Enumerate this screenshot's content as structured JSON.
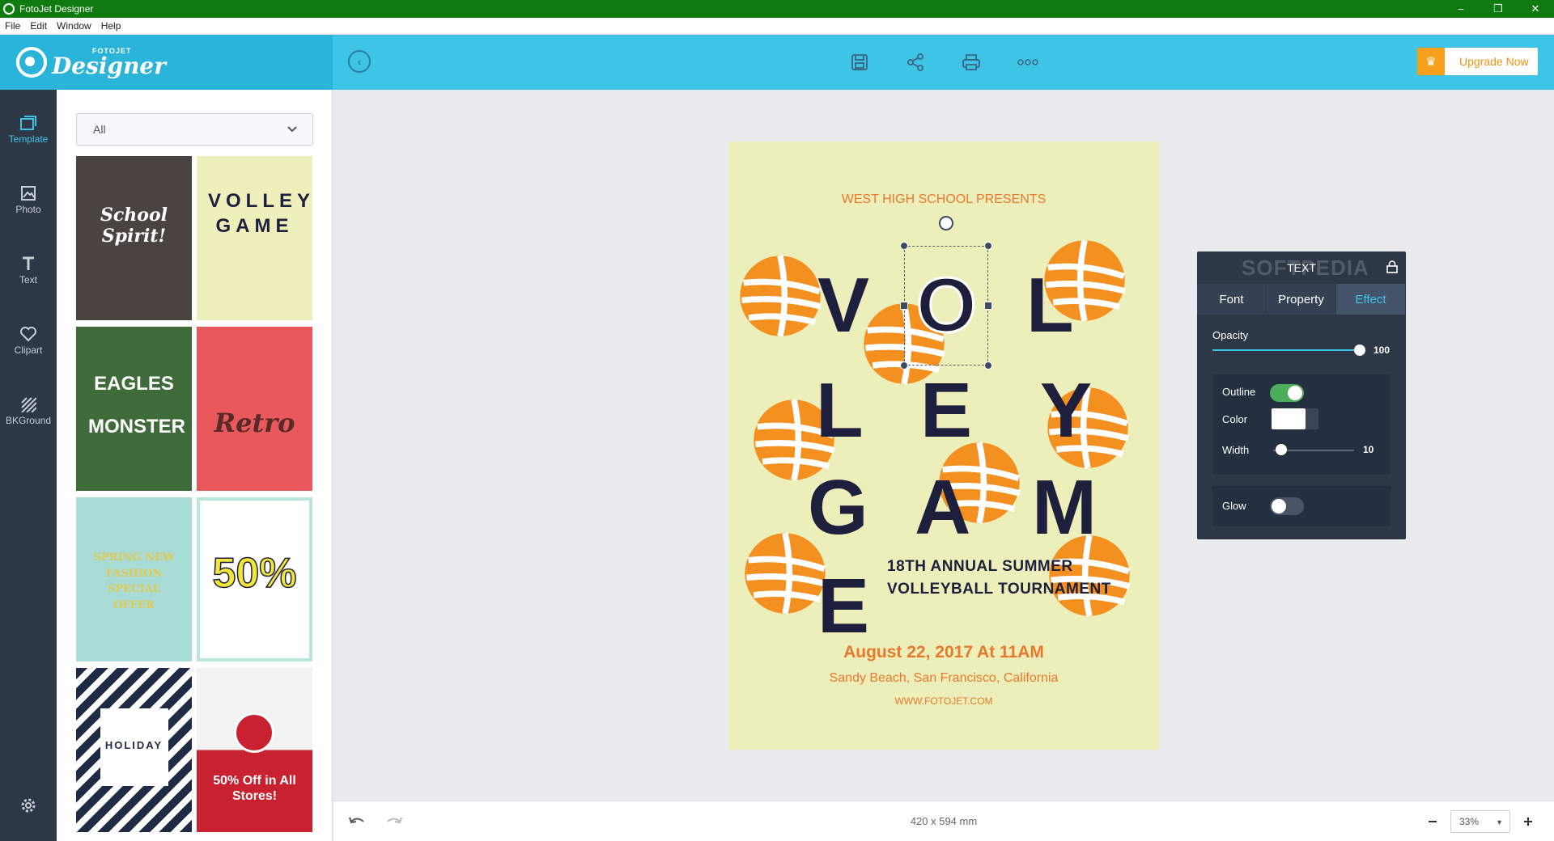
{
  "titlebar": {
    "title": "FotoJet Designer",
    "minimize": "−",
    "maximize": "❐",
    "close": "✕"
  },
  "menu": [
    "File",
    "Edit",
    "Window",
    "Help"
  ],
  "header": {
    "logo_small": "FOTOJET",
    "logo_big": "Designer",
    "upgrade_label": "Upgrade Now",
    "accent": "#3ec4e6",
    "upgrade_color": "#f6a11c"
  },
  "leftnav": {
    "items": [
      {
        "label": "Template",
        "icon": "template-icon",
        "active": true
      },
      {
        "label": "Photo",
        "icon": "photo-icon"
      },
      {
        "label": "Text",
        "icon": "text-icon"
      },
      {
        "label": "Clipart",
        "icon": "heart-icon"
      },
      {
        "label": "BKGround",
        "icon": "background-icon"
      }
    ]
  },
  "panel": {
    "filter_value": "All",
    "templates": [
      {
        "title": "School Spirit!",
        "bg": "#4a433f",
        "color": "#ffffff"
      },
      {
        "title": "VOLLEY GAME",
        "bg": "#eeefbb",
        "color": "#1d1f3c"
      },
      {
        "title": "EAGLES MONSTER",
        "bg": "#3f6b3a",
        "color": "#ffffff"
      },
      {
        "title": "Retro",
        "bg": "#e9585a",
        "color": "#5a2a2a"
      },
      {
        "title": "SPRING NEW FASHION SPECIAL OFFER",
        "bg": "#a9dcd7",
        "color": "#e2c94b"
      },
      {
        "title": "50%",
        "bg": "#ffffff",
        "color": "#1d1f3c"
      },
      {
        "title": "HOLIDAY",
        "bg": "#1f2b45",
        "color": "#1f2b45"
      },
      {
        "title": "50% Off in All Stores!",
        "bg": "#c8212f",
        "color": "#ffffff"
      }
    ]
  },
  "poster": {
    "presents": "WEST HIGH SCHOOL PRESENTS",
    "letters": [
      "V",
      "O",
      "L",
      "L",
      "E",
      "Y",
      "G",
      "A",
      "M",
      "E"
    ],
    "subhead_1": "18TH ANNUAL SUMMER",
    "subhead_2": "VOLLEYBALL TOURNAMENT",
    "date": "August 22, 2017 At 11AM",
    "location": "Sandy Beach, San Francisco, California",
    "site": "WWW.FOTOJET.COM",
    "bg": "#edefba",
    "ball_color": "#f39020",
    "text_color": "#1d1f3c"
  },
  "text_panel": {
    "title": "TEXT",
    "watermark": "SOFTPEDIA",
    "tabs": [
      "Font",
      "Property",
      "Effect"
    ],
    "active_tab": "Effect",
    "opacity_label": "Opacity",
    "opacity_value": "100",
    "outline_label": "Outline",
    "outline_on": true,
    "color_label": "Color",
    "width_label": "Width",
    "width_value": "10",
    "glow_label": "Glow",
    "glow_on": false
  },
  "bottom": {
    "size_label": "420 x 594 mm",
    "zoom": "33%"
  }
}
